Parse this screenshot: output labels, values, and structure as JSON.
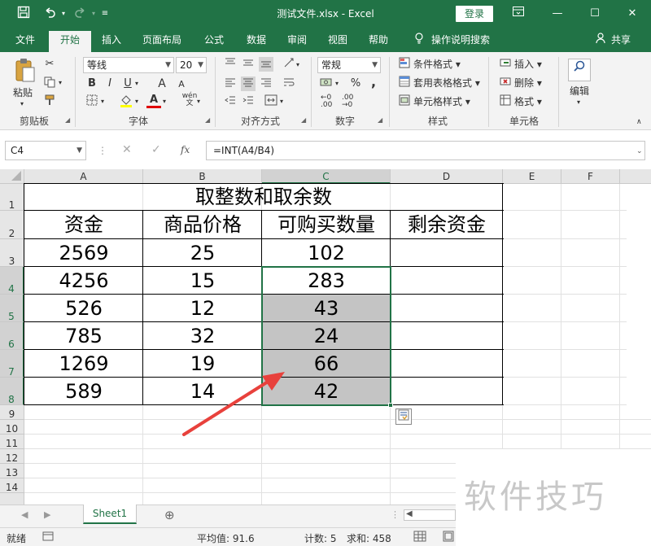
{
  "window": {
    "title": "测试文件.xlsx  -  Excel",
    "login_label": "登录",
    "icons": [
      "save-icon",
      "undo-icon",
      "redo-icon",
      "customize-icon",
      "ribbon-display-icon",
      "minimize-icon",
      "maximize-icon",
      "close-icon"
    ]
  },
  "tabs": [
    {
      "label": "文件"
    },
    {
      "label": "开始"
    },
    {
      "label": "插入"
    },
    {
      "label": "页面布局"
    },
    {
      "label": "公式"
    },
    {
      "label": "数据"
    },
    {
      "label": "审阅"
    },
    {
      "label": "视图"
    },
    {
      "label": "帮助"
    }
  ],
  "tell_me": "操作说明搜索",
  "share_label": "共享",
  "ribbon": {
    "clipboard": {
      "paste_label": "粘贴",
      "group_label": "剪贴板"
    },
    "font": {
      "font_name": "等线",
      "font_size": "20",
      "bold": "B",
      "italic": "I",
      "underline": "U",
      "grow": "A",
      "shrink": "A",
      "color_letter": "A",
      "phonetic": "wén",
      "group_label": "字体"
    },
    "alignment": {
      "group_label": "对齐方式"
    },
    "number": {
      "format": "常规",
      "percent": "%",
      "comma": ",",
      "group_label": "数字"
    },
    "styles": {
      "conditional": "条件格式",
      "table": "套用表格格式",
      "cell": "单元格样式",
      "group_label": "样式"
    },
    "cells": {
      "insert": "插入",
      "delete": "删除",
      "format": "格式",
      "group_label": "单元格"
    },
    "editing": {
      "label": "编辑"
    }
  },
  "formula_bar": {
    "name_box": "C4",
    "formula": "=INT(A4/B4)",
    "fx": "fx"
  },
  "grid": {
    "columns": [
      "A",
      "B",
      "C",
      "D",
      "E",
      "F"
    ],
    "rows": [
      "1",
      "2",
      "3",
      "4",
      "5",
      "6",
      "7",
      "8",
      "9",
      "10",
      "11",
      "12",
      "13",
      "14"
    ],
    "table_title": "取整数和取余数",
    "headers": [
      "资金",
      "商品价格",
      "可购买数量",
      "剩余资金"
    ],
    "data": [
      [
        "2569",
        "25",
        "102",
        ""
      ],
      [
        "4256",
        "15",
        "283",
        ""
      ],
      [
        "526",
        "12",
        "43",
        ""
      ],
      [
        "785",
        "32",
        "24",
        ""
      ],
      [
        "1269",
        "19",
        "66",
        ""
      ],
      [
        "589",
        "14",
        "42",
        ""
      ]
    ]
  },
  "sheets": [
    {
      "name": "Sheet1"
    }
  ],
  "status": {
    "ready": "就绪",
    "average": "平均值: 91.6",
    "count": "计数: 5",
    "sum": "求和: 458"
  },
  "watermark": "软件技巧",
  "colors": {
    "accent": "#217346",
    "selected_fill": "#c4c4c4",
    "arrow": "#e8413c"
  }
}
